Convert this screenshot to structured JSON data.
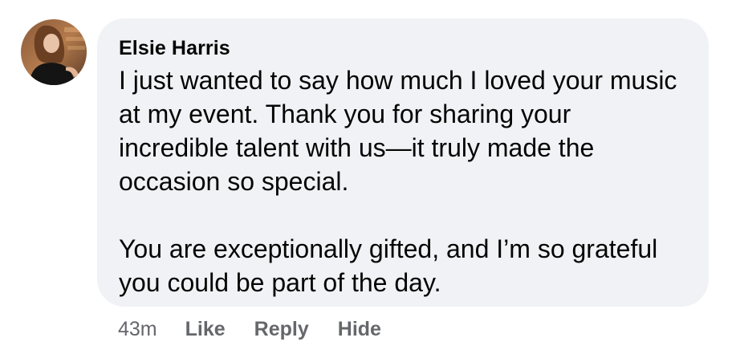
{
  "comment": {
    "author": "Elsie Harris",
    "avatar_icon": "profile-photo-avatar",
    "paragraphs": [
      "I just wanted to say how much I loved your music at my event. Thank you for sharing your incredible talent with us—it truly made the occasion so special.",
      "You are exceptionally gifted, and I’m so grateful you could be part of the day."
    ],
    "timestamp": "43m",
    "actions": {
      "like": "Like",
      "reply": "Reply",
      "hide": "Hide"
    }
  },
  "colors": {
    "bubble_background": "#f0f2f5",
    "text_primary": "#050505",
    "text_secondary": "#65676b"
  }
}
